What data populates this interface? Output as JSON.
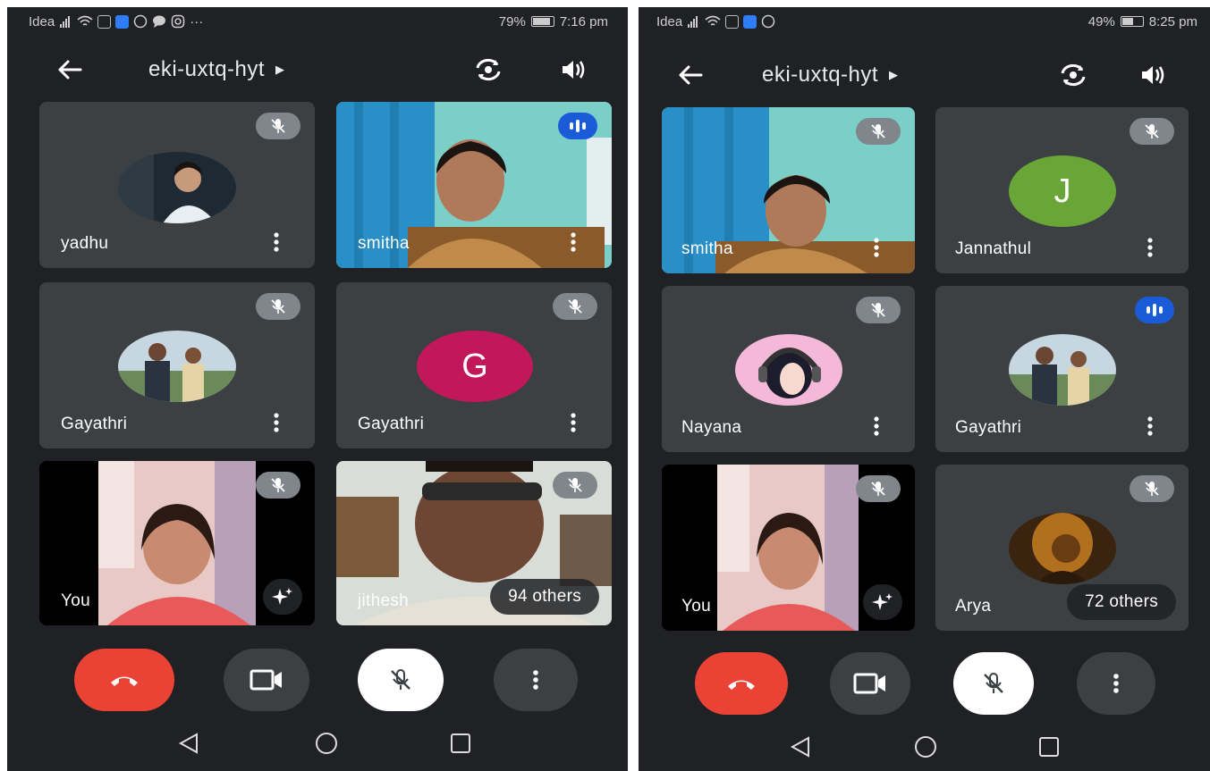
{
  "left": {
    "status": {
      "carrier": "Idea",
      "battery": "79%",
      "battery_level": 0.79,
      "time": "7:16 pm",
      "extra_icons": "···"
    },
    "meeting_code": "eki-uxtq-hyt",
    "participants": [
      {
        "name": "yadhu",
        "muted": true,
        "speaking": false,
        "media": "photo"
      },
      {
        "name": "smitha",
        "muted": false,
        "speaking": true,
        "media": "video"
      },
      {
        "name": "Gayathri",
        "muted": true,
        "speaking": false,
        "media": "photo"
      },
      {
        "name": "Gayathri",
        "muted": true,
        "speaking": false,
        "media": "letter",
        "letter": "G",
        "avatar_color": "#c2185b"
      },
      {
        "name": "You",
        "muted": true,
        "speaking": false,
        "media": "self-video"
      },
      {
        "name": "jithesh",
        "muted": true,
        "speaking": false,
        "media": "video"
      }
    ],
    "others_label": "94 others"
  },
  "right": {
    "status": {
      "carrier": "Idea",
      "battery": "49%",
      "battery_level": 0.49,
      "time": "8:25 pm"
    },
    "meeting_code": "eki-uxtq-hyt",
    "participants": [
      {
        "name": "smitha",
        "muted": true,
        "speaking": false,
        "media": "video"
      },
      {
        "name": "Jannathul",
        "muted": true,
        "speaking": false,
        "media": "letter",
        "letter": "J",
        "avatar_color": "#6aa538"
      },
      {
        "name": "Nayana",
        "muted": true,
        "speaking": false,
        "media": "photo"
      },
      {
        "name": "Gayathri",
        "muted": false,
        "speaking": true,
        "media": "photo"
      },
      {
        "name": "You",
        "muted": true,
        "speaking": false,
        "media": "self-video"
      },
      {
        "name": "Arya",
        "muted": true,
        "speaking": false,
        "media": "photo"
      }
    ],
    "others_label": "72 others"
  },
  "colors": {
    "background": "#202124",
    "tile": "#3c4043",
    "end_call": "#ea4335",
    "mute_badge": "#80868b",
    "speaking_badge": "#1a5bd8"
  },
  "icons": {
    "back": "arrow-left-icon",
    "flip_camera": "flip-camera-icon",
    "audio_output": "speaker-icon",
    "end_call": "phone-hangup-icon",
    "camera": "video-camera-icon",
    "microphone": "mic-off-icon",
    "more": "more-vert-icon",
    "effects": "sparkle-icon",
    "nav_back": "triangle-back-icon",
    "nav_home": "circle-home-icon",
    "nav_recents": "square-recents-icon"
  }
}
